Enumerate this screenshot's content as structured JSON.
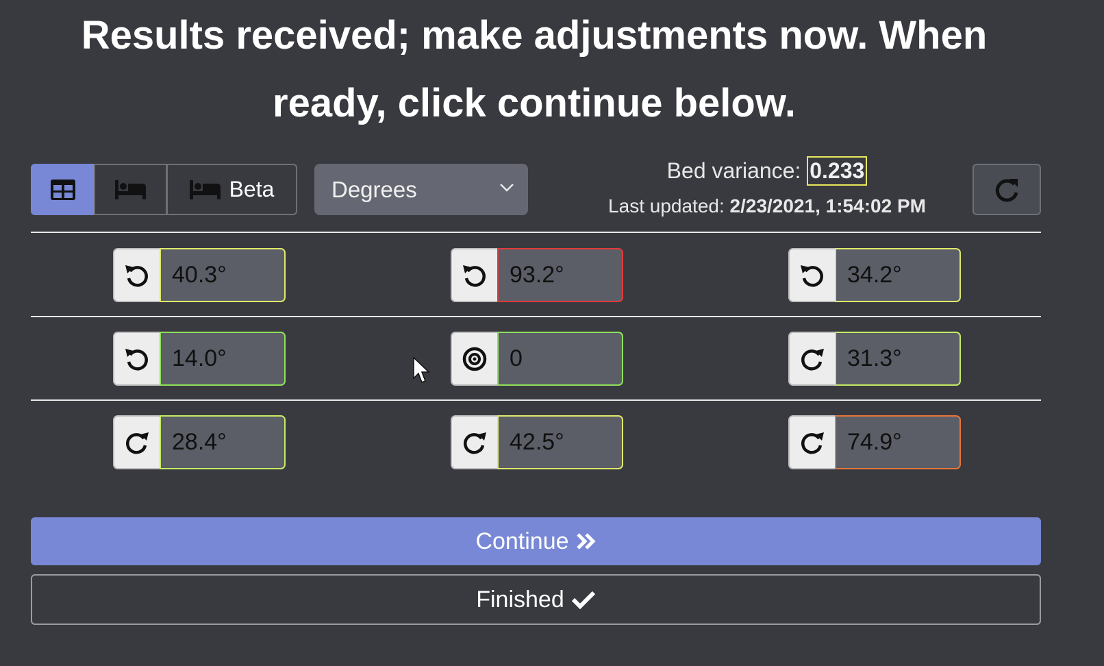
{
  "heading": {
    "line1": "Results received; make adjustments now. When",
    "line2": "ready, click continue below."
  },
  "view_toggle": {
    "items": [
      {
        "icon": "table-icon",
        "active": true
      },
      {
        "icon": "bed-icon",
        "active": false
      },
      {
        "icon": "bed-icon",
        "label": "Beta",
        "active": false
      }
    ]
  },
  "units_select": {
    "selected": "Degrees"
  },
  "status": {
    "variance_label": "Bed variance:",
    "variance_value": "0.233",
    "updated_label": "Last updated:",
    "updated_value": "2/23/2021, 1:54:02 PM"
  },
  "grid": [
    {
      "direction": "counterclockwise-icon",
      "value": "40.3°",
      "status_color": "#dfe86a"
    },
    {
      "direction": "counterclockwise-icon",
      "value": "93.2°",
      "status_color": "#e23a3a"
    },
    {
      "direction": "counterclockwise-icon",
      "value": "34.2°",
      "status_color": "#dfe86a"
    },
    {
      "direction": "counterclockwise-icon",
      "value": "14.0°",
      "status_color": "#8fe05a"
    },
    {
      "direction": "target-icon",
      "value": "0",
      "status_color": "#8fe05a"
    },
    {
      "direction": "clockwise-icon",
      "value": "31.3°",
      "status_color": "#c6ea64"
    },
    {
      "direction": "clockwise-icon",
      "value": "28.4°",
      "status_color": "#c6ea64"
    },
    {
      "direction": "clockwise-icon",
      "value": "42.5°",
      "status_color": "#dfe86a"
    },
    {
      "direction": "clockwise-icon",
      "value": "74.9°",
      "status_color": "#e8753a"
    }
  ],
  "actions": {
    "continue_label": "Continue",
    "finished_label": "Finished"
  },
  "colors": {
    "accent": "#7888d6",
    "background": "#393a40"
  }
}
